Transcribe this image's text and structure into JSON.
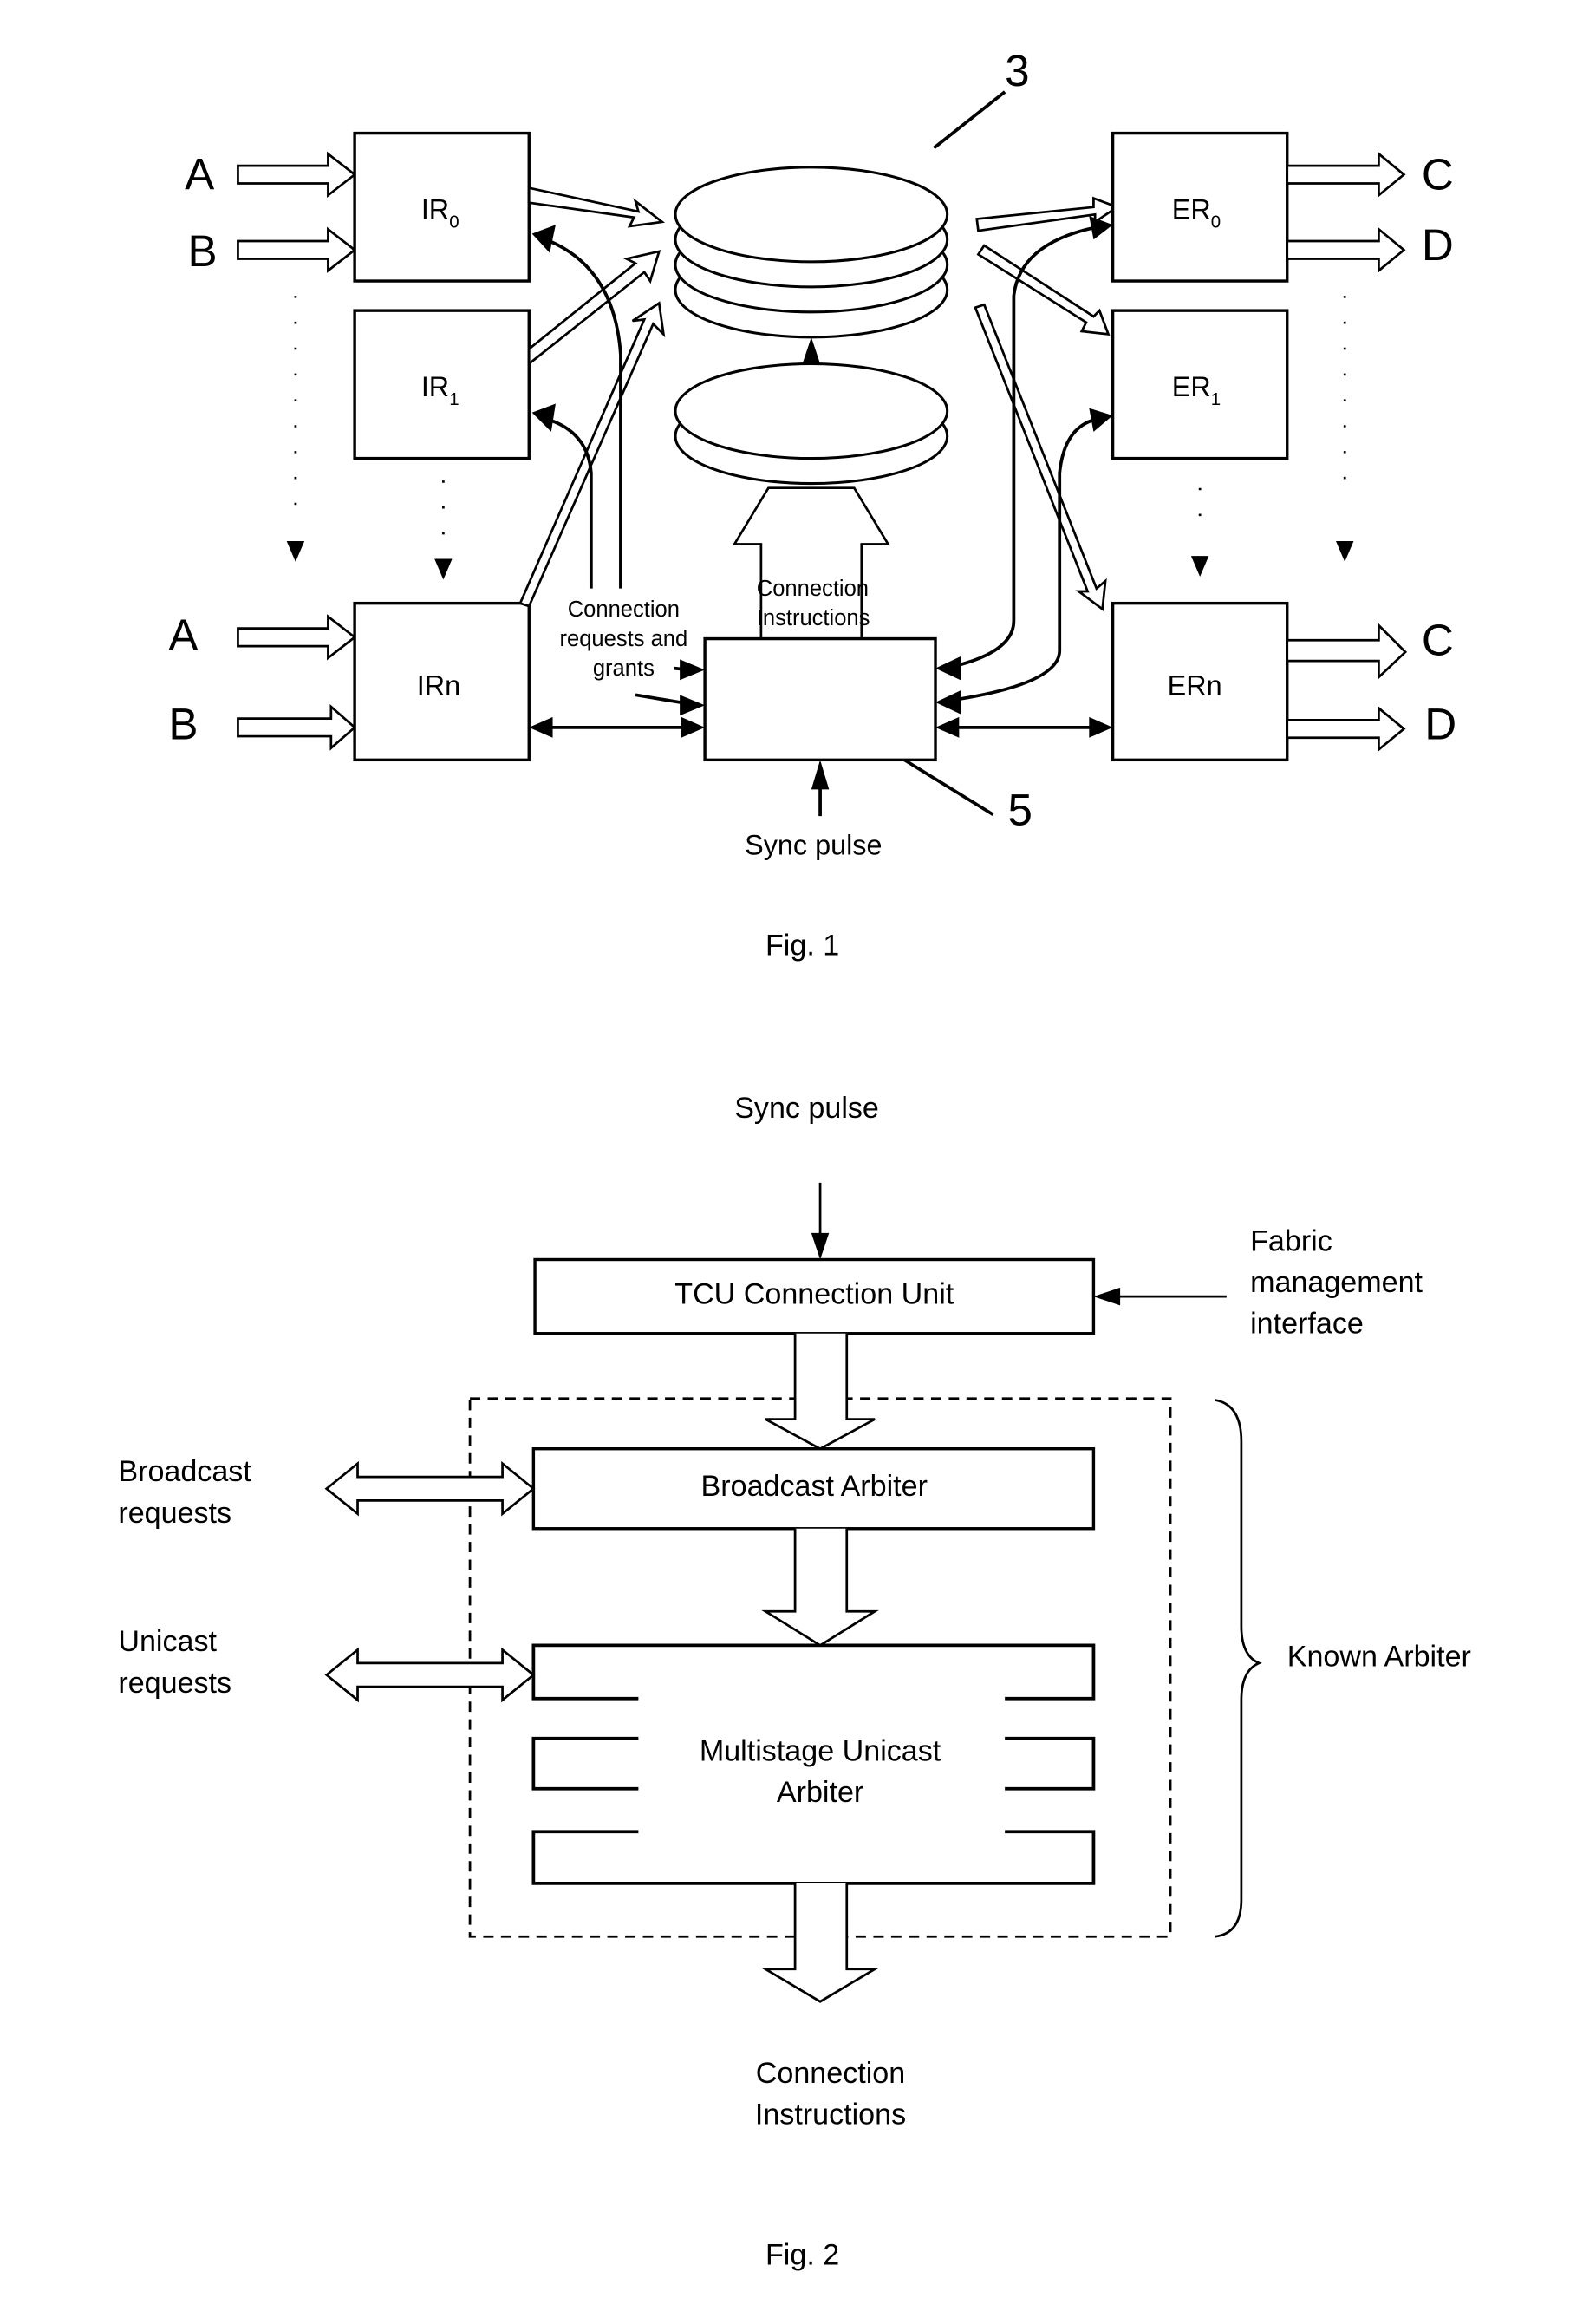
{
  "fig1": {
    "caption": "Fig. 1",
    "ref_fabric": "3",
    "ref_controller": "5",
    "inputs": {
      "top": [
        "A",
        "B"
      ],
      "bottom": [
        "A",
        "B"
      ]
    },
    "outputs": {
      "top": [
        "C",
        "D"
      ],
      "bottom": [
        "C",
        "D"
      ]
    },
    "ingress": [
      {
        "base": "IR",
        "sub": "0"
      },
      {
        "base": "IR",
        "sub": "1"
      },
      {
        "base": "IRn",
        "sub": ""
      }
    ],
    "egress": [
      {
        "base": "ER",
        "sub": "0"
      },
      {
        "base": "ER",
        "sub": "1"
      },
      {
        "base": "ERn",
        "sub": ""
      }
    ],
    "label_requests": [
      "Connection",
      "requests and",
      "grants"
    ],
    "label_instructions": [
      "Connection",
      "Instructions"
    ],
    "label_sync": "Sync pulse"
  },
  "fig2": {
    "caption": "Fig. 2",
    "sync": "Sync pulse",
    "tcu": "TCU Connection Unit",
    "fabric_mgmt": [
      "Fabric",
      "management",
      "interface"
    ],
    "broadcast_arbiter": "Broadcast Arbiter",
    "broadcast_requests": [
      "Broadcast",
      "requests"
    ],
    "unicast_requests": [
      "Unicast",
      "requests"
    ],
    "multistage": [
      "Multistage Unicast",
      "Arbiter"
    ],
    "known_arbiter": "Known Arbiter",
    "output": [
      "Connection",
      "Instructions"
    ]
  }
}
